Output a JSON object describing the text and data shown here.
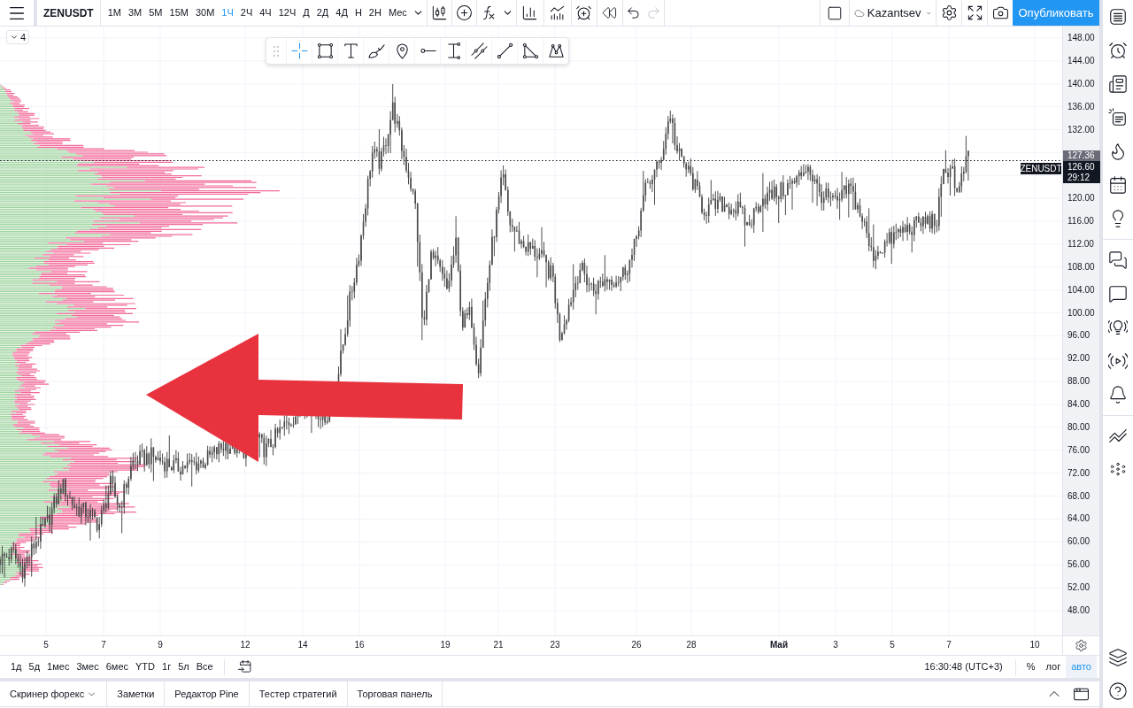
{
  "top_toolbar": {
    "symbol": "ZENUSDT",
    "intervals": [
      {
        "label": "1М",
        "selected": false
      },
      {
        "label": "3М",
        "selected": false
      },
      {
        "label": "5М",
        "selected": false
      },
      {
        "label": "15М",
        "selected": false
      },
      {
        "label": "30М",
        "selected": false
      },
      {
        "label": "1Ч",
        "selected": true
      },
      {
        "label": "2Ч",
        "selected": false
      },
      {
        "label": "4Ч",
        "selected": false
      },
      {
        "label": "12Ч",
        "selected": false
      },
      {
        "label": "Д",
        "selected": false
      },
      {
        "label": "2Д",
        "selected": false
      },
      {
        "label": "4Д",
        "selected": false
      },
      {
        "label": "Н",
        "selected": false
      },
      {
        "label": "2Н",
        "selected": false
      },
      {
        "label": "Мес",
        "selected": false
      }
    ],
    "history": [
      {
        "kind": "undo",
        "disabled": false
      },
      {
        "kind": "redo",
        "disabled": true
      }
    ],
    "layout_name": "Kazantsev",
    "publish_button": "Опубликовать"
  },
  "chart": {
    "collapse_count": "4",
    "drawing_tools": [
      {
        "kind": "crosshair",
        "selected": true
      },
      {
        "kind": "rectangle",
        "selected": false
      },
      {
        "kind": "text",
        "selected": false
      },
      {
        "kind": "brush",
        "selected": false
      },
      {
        "kind": "pin",
        "selected": false
      },
      {
        "kind": "horizontal_line",
        "selected": false
      },
      {
        "kind": "range",
        "selected": false
      },
      {
        "kind": "channel",
        "selected": false
      },
      {
        "kind": "trend_line",
        "selected": false
      },
      {
        "kind": "triangle",
        "selected": false
      },
      {
        "kind": "pattern",
        "selected": false
      }
    ],
    "symbol_tag": "ZENUSDT"
  },
  "price_axis": {
    "ticks": [
      "148.00",
      "144.00",
      "140.00",
      "136.00",
      "132.00",
      "120.00",
      "116.00",
      "112.00",
      "108.00",
      "104.00",
      "100.00",
      "96.00",
      "92.00",
      "88.00",
      "84.00",
      "80.00",
      "76.00",
      "72.00",
      "68.00",
      "64.00",
      "60.00",
      "56.00",
      "52.00",
      "48.00"
    ],
    "last_price": "127.36",
    "current_price": "126.60",
    "countdown": "29:12"
  },
  "time_axis": {
    "ticks": [
      {
        "label": "5",
        "kind": "day"
      },
      {
        "label": "7",
        "kind": "day"
      },
      {
        "label": "9",
        "kind": "day"
      },
      {
        "label": "12",
        "kind": "day"
      },
      {
        "label": "14",
        "kind": "day"
      },
      {
        "label": "16",
        "kind": "day"
      },
      {
        "label": "19",
        "kind": "day"
      },
      {
        "label": "21",
        "kind": "day"
      },
      {
        "label": "23",
        "kind": "day"
      },
      {
        "label": "26",
        "kind": "day"
      },
      {
        "label": "28",
        "kind": "day"
      },
      {
        "label": "Май",
        "kind": "month"
      },
      {
        "label": "3",
        "kind": "day"
      },
      {
        "label": "5",
        "kind": "day"
      },
      {
        "label": "7",
        "kind": "day"
      },
      {
        "label": "10",
        "kind": "day"
      }
    ]
  },
  "range_bar": {
    "ranges": [
      {
        "label": "1д",
        "selected": false
      },
      {
        "label": "5д",
        "selected": false
      },
      {
        "label": "1мес",
        "selected": false
      },
      {
        "label": "3мес",
        "selected": false
      },
      {
        "label": "6мес",
        "selected": false
      },
      {
        "label": "YTD",
        "selected": false
      },
      {
        "label": "1г",
        "selected": false
      },
      {
        "label": "5л",
        "selected": false
      },
      {
        "label": "Все",
        "selected": false
      }
    ],
    "clock": "16:30:48 (UTC+3)",
    "scale_modes": [
      {
        "label": "%",
        "selected": false
      },
      {
        "label": "лог",
        "selected": false
      },
      {
        "label": "авто",
        "selected": true
      }
    ]
  },
  "bottom_panel": {
    "tabs": [
      {
        "label": "Скринер форекс",
        "has_menu": true
      },
      {
        "label": "Заметки",
        "has_menu": false
      },
      {
        "label": "Редактор Pine",
        "has_menu": false
      },
      {
        "label": "Тестер стратегий",
        "has_menu": false
      },
      {
        "label": "Торговая панель",
        "has_menu": false
      }
    ]
  }
}
